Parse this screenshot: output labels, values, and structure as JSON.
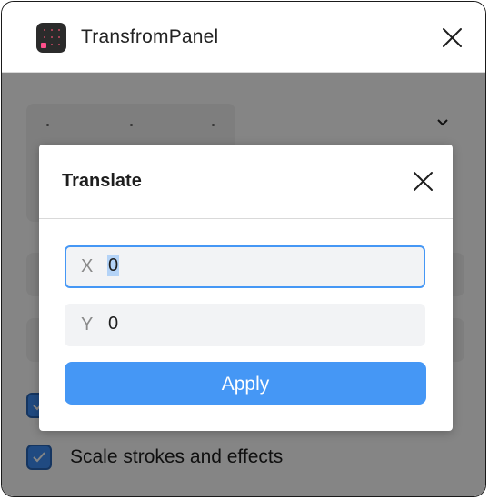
{
  "window": {
    "title": "TransfromPanel",
    "icon": "app-grid-icon",
    "close_icon": "close-icon"
  },
  "background_panel": {
    "checkboxes": [
      {
        "checked": true,
        "label": ""
      },
      {
        "checked": true,
        "label": "Scale strokes and effects"
      }
    ]
  },
  "dialog": {
    "title": "Translate",
    "close_icon": "close-icon",
    "fields": [
      {
        "axis": "X",
        "value": "0",
        "focused": true,
        "selected": true
      },
      {
        "axis": "Y",
        "value": "0",
        "focused": false,
        "selected": false
      }
    ],
    "apply_label": "Apply"
  },
  "colors": {
    "accent": "#4597f5",
    "overlay": "rgba(0,0,0,0.48)",
    "field_bg": "#f2f3f5",
    "app_icon_bg": "#2b2b2b",
    "app_icon_accent": "#ff4f8b"
  }
}
